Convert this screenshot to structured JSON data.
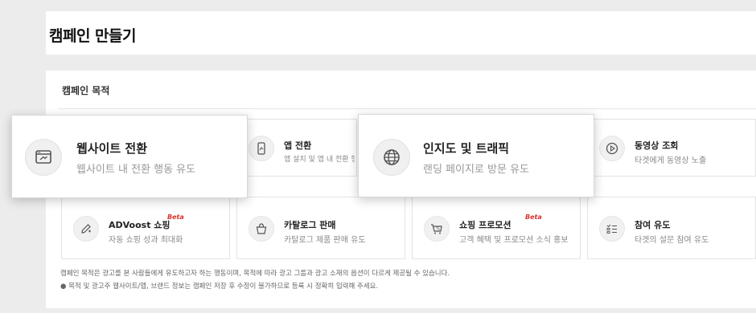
{
  "page": {
    "title": "캠페인 만들기"
  },
  "objective": {
    "section_title": "캠페인 목적",
    "cards": [
      {
        "name": "웹사이트 전환",
        "desc": "웹사이트 내 전환 행동 유도",
        "icon": "browser-conversion-icon"
      },
      {
        "name": "앱 전환",
        "desc": "앱 설치 및 앱 내 전환 행동 유도",
        "icon": "mobile-app-icon"
      },
      {
        "name": "인지도 및 트래픽",
        "desc": "랜딩 페이지로 방문 유도",
        "icon": "globe-icon"
      },
      {
        "name": "동영상 조회",
        "desc": "타겟에게 동영상 노출",
        "icon": "play-icon"
      },
      {
        "name": "ADVoost 쇼핑",
        "desc": "자동 쇼핑 성과 최대화",
        "badge": "Beta",
        "icon": "pencil-sparkle-icon"
      },
      {
        "name": "카탈로그 판매",
        "desc": "카탈로그 제품 판매 유도",
        "icon": "shopping-bag-icon"
      },
      {
        "name": "쇼핑 프로모션",
        "desc": "고객 혜택 및 프로모션 소식 홍보",
        "badge": "Beta",
        "icon": "cart-discount-icon"
      },
      {
        "name": "참여 유도",
        "desc": "타겟의 설문 참여 유도",
        "icon": "survey-checklist-icon"
      }
    ],
    "notes": [
      "캠페인 목적은 광고를 본 사람들에게 유도하고자 하는 행동이며, 목적에 따라 광고 그룹과 광고 소재의 옵션이 다르게 제공될 수 있습니다.",
      "● 목적 및 광고주 웹사이트/앱, 브랜드 정보는 캠페인 저장 후 수정이 불가하므로 등록 시 정확히 입력해 주세요."
    ]
  },
  "colors": {
    "beta": "#d9312a",
    "background": "#ececec"
  }
}
